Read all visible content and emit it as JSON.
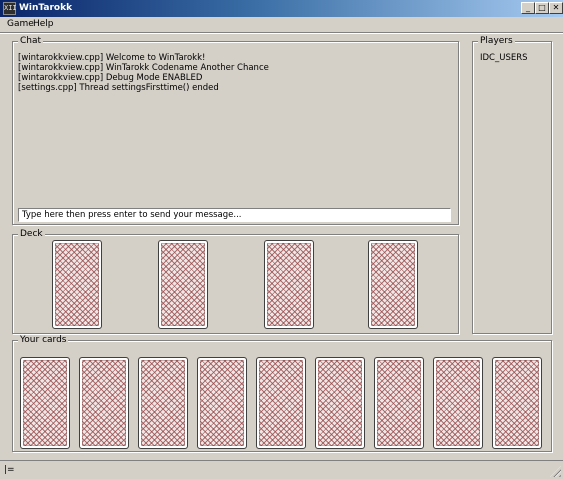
{
  "window": {
    "title": "WinTarokk",
    "app_icon": "tarokk-app-icon",
    "app_icon_glyph": "XII",
    "controls": {
      "minimize": "_",
      "maximize": "□",
      "close": "✕"
    }
  },
  "menu": {
    "items": [
      "Game",
      "Help"
    ]
  },
  "chat": {
    "label": "Chat",
    "messages": [
      "[wintarokkview.cpp] Welcome to WinTarokk!",
      "[wintarokkview.cpp] WinTarokk Codename Another Chance",
      "[wintarokkview.cpp] Debug Mode ENABLED",
      "[settings.cpp] Thread settingsFirsttime() ended"
    ],
    "input_placeholder": "Type here then press enter to send your message..."
  },
  "players": {
    "label": "Players",
    "items": [
      "IDC_USERS"
    ]
  },
  "deck": {
    "label": "Deck",
    "card_count": 4
  },
  "your_cards": {
    "label": "Your cards",
    "card_count": 9
  },
  "status": {
    "text": "|="
  }
}
